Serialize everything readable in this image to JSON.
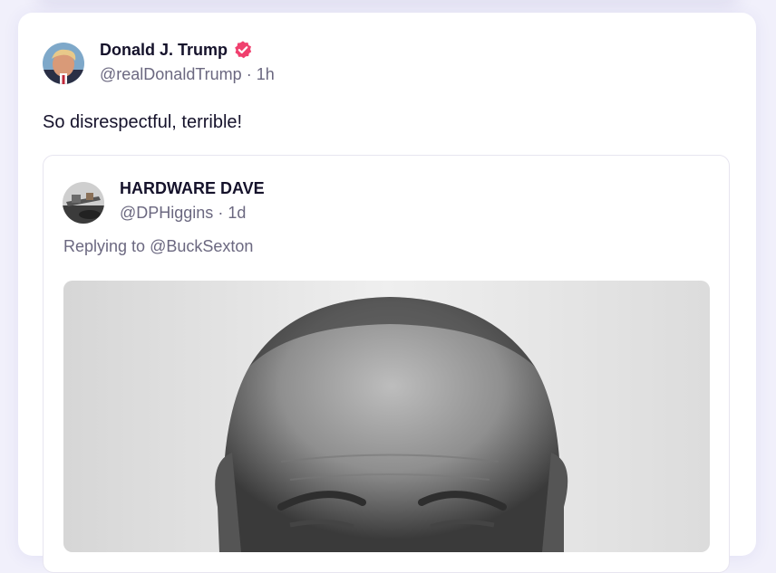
{
  "post": {
    "author_name": "Donald J. Trump",
    "author_handle": "@realDonaldTrump",
    "separator": "·",
    "time": "1h",
    "text": "So disrespectful, terrible!",
    "avatar_icon": "user-avatar",
    "verified_icon": "verified-badge-icon",
    "accent_color": "#f0406e"
  },
  "quoted": {
    "author_name": "HARDWARE DAVE",
    "author_handle": "@DPHiggins",
    "separator": "·",
    "time": "1d",
    "replying_prefix": "Replying to",
    "replying_to": "@BuckSexton",
    "avatar_icon": "user-avatar",
    "media_icon": "photo"
  }
}
